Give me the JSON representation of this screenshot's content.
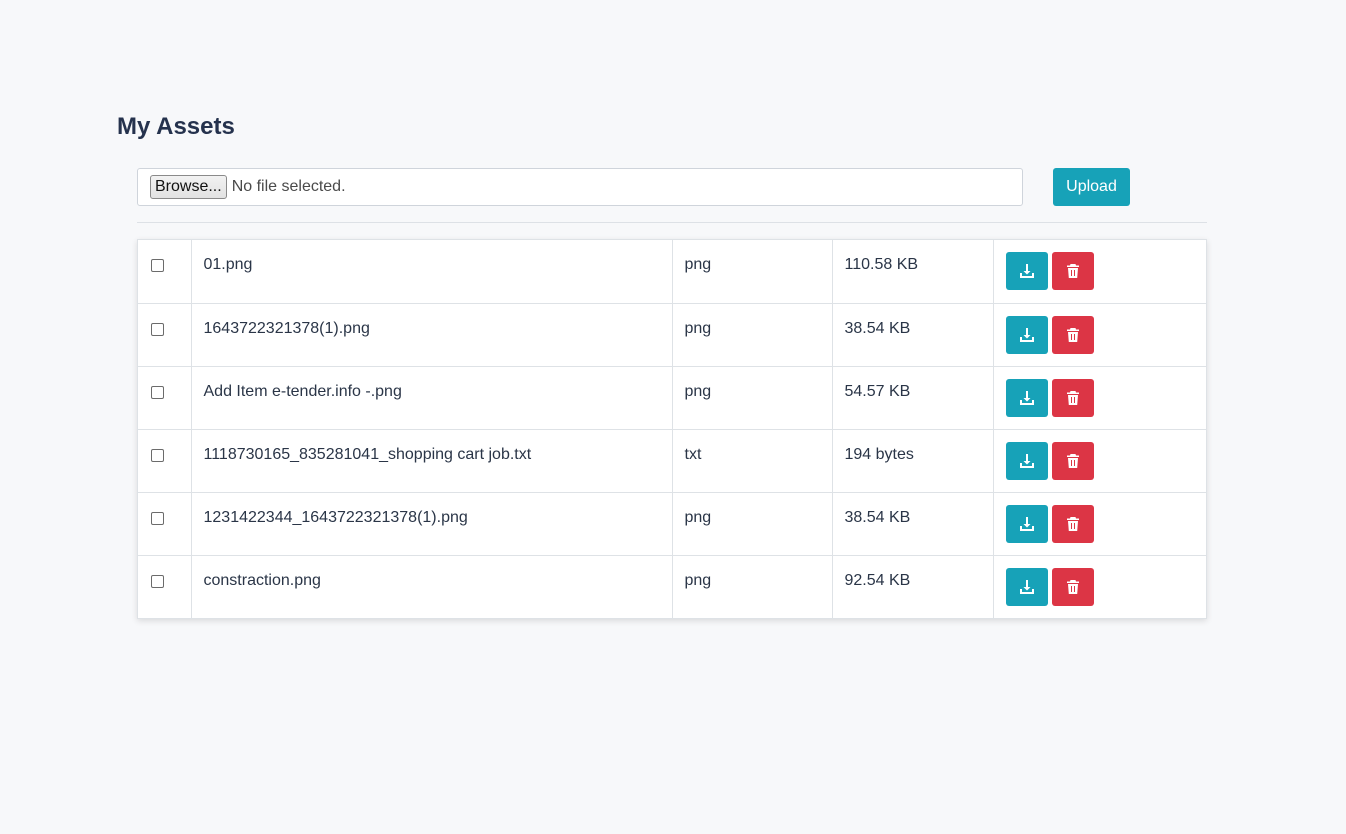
{
  "page": {
    "title": "My Assets"
  },
  "upload": {
    "browse_label": "Browse...",
    "file_status": "No file selected.",
    "upload_label": "Upload"
  },
  "colors": {
    "accent": "#17a2b8",
    "danger": "#dc3545",
    "title": "#25324d",
    "background": "#f7f8fa"
  },
  "icons": {
    "download": "download-icon",
    "delete": "trash-icon"
  },
  "files": [
    {
      "name": "01.png",
      "type": "png",
      "size": "110.58 KB"
    },
    {
      "name": "1643722321378(1).png",
      "type": "png",
      "size": "38.54 KB"
    },
    {
      "name": "Add Item e-tender.info -.png",
      "type": "png",
      "size": "54.57 KB"
    },
    {
      "name": "1118730165_835281041_shopping cart job.txt",
      "type": "txt",
      "size": "194 bytes"
    },
    {
      "name": "1231422344_1643722321378(1).png",
      "type": "png",
      "size": "38.54 KB"
    },
    {
      "name": "constraction.png",
      "type": "png",
      "size": "92.54 KB"
    }
  ]
}
